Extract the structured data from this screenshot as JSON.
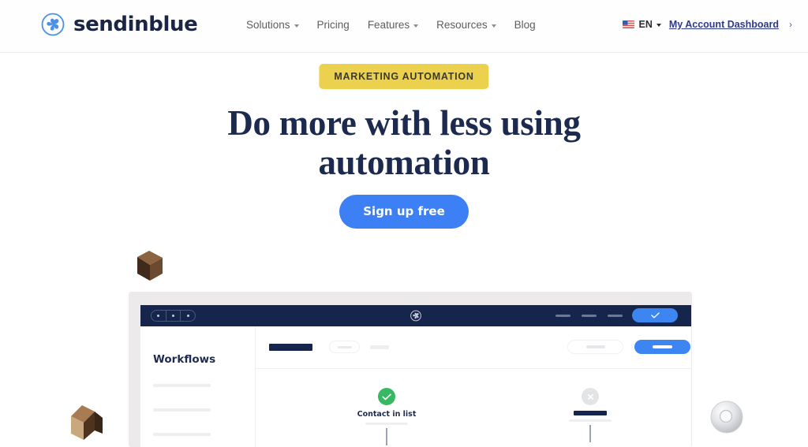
{
  "header": {
    "brand": {
      "name": "sendinblue",
      "icon": "sendinblue-pinwheel-logo"
    },
    "nav": [
      {
        "label": "Solutions",
        "has_dropdown": true
      },
      {
        "label": "Pricing",
        "has_dropdown": false
      },
      {
        "label": "Features",
        "has_dropdown": true
      },
      {
        "label": "Resources",
        "has_dropdown": true
      },
      {
        "label": "Blog",
        "has_dropdown": false
      }
    ],
    "language": {
      "code": "EN",
      "flag": "us-flag-icon"
    },
    "account_link": "My Account Dashboard",
    "account_chevron": "›"
  },
  "hero": {
    "badge": "MARKETING AUTOMATION",
    "headline_line1": "Do more with less using",
    "headline_line2": "automation",
    "cta": "Sign up free"
  },
  "mockup": {
    "titlebar": {
      "logo_icon": "sendinblue-pinwheel-logo",
      "check_icon": "check-icon"
    },
    "sidebar": {
      "title": "Workflows"
    },
    "nodes": [
      {
        "label": "Contact in list",
        "icon": "check-circle-icon",
        "state": "success"
      },
      {
        "label": "",
        "icon": "close-circle-icon",
        "state": "muted"
      }
    ]
  },
  "colors": {
    "brand_blue": "#3d7ff5",
    "navy": "#16254c",
    "badge_yellow": "#ecd14f",
    "success_green": "#38b863",
    "link_blue": "#2d3a8c"
  }
}
